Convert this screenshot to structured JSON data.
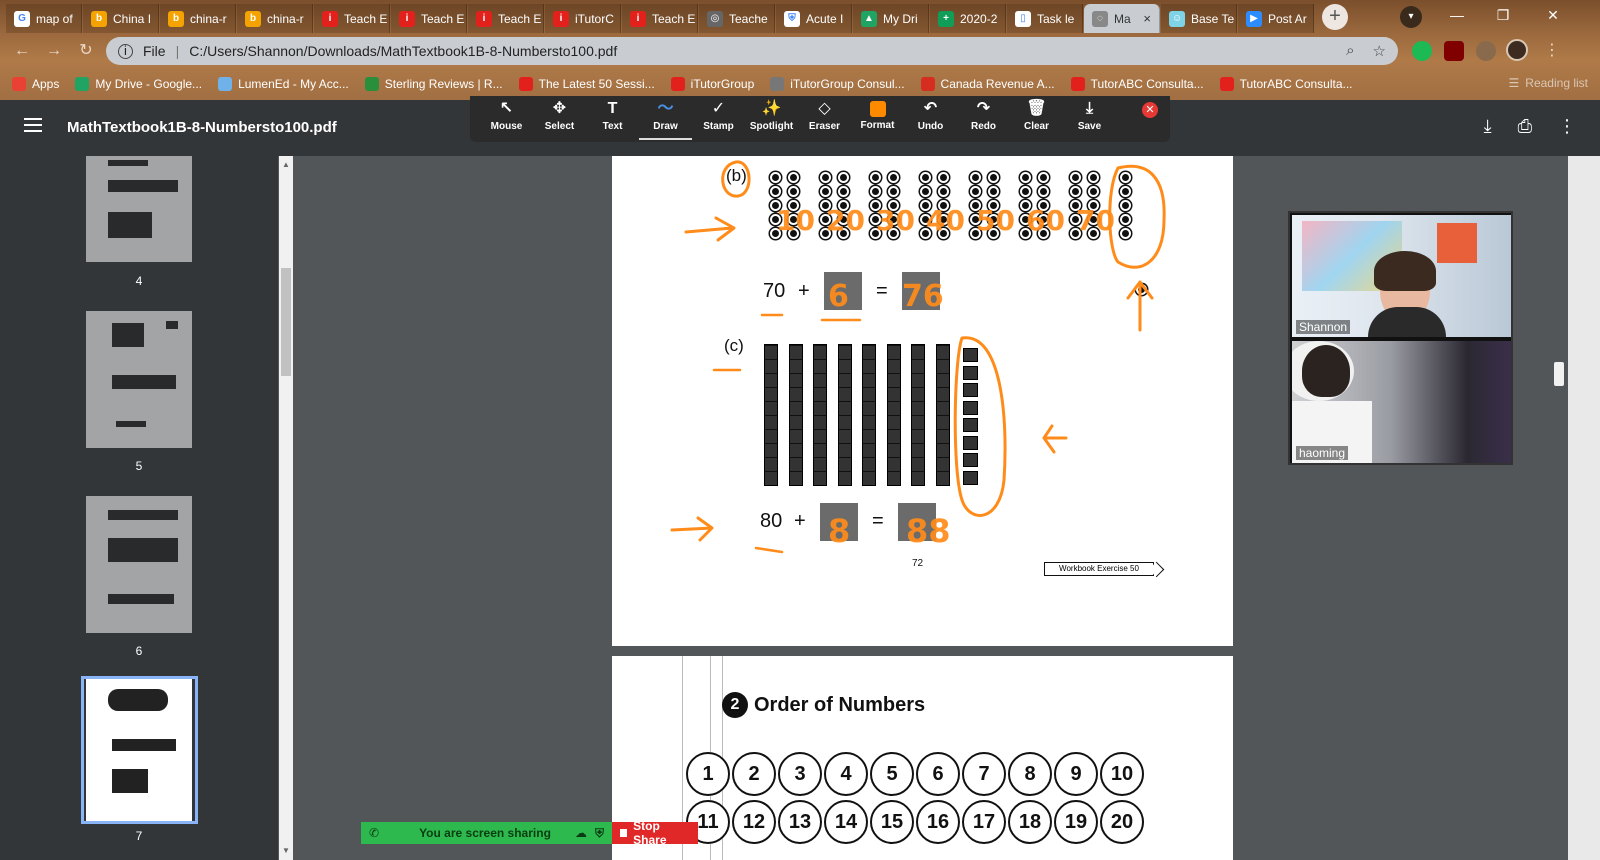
{
  "browser": {
    "tabs": [
      {
        "label": "map of",
        "color": "#ffffff",
        "glyph": "G"
      },
      {
        "label": "China I",
        "color": "#f4a300",
        "glyph": "b"
      },
      {
        "label": "china-r",
        "color": "#f4a300",
        "glyph": "b"
      },
      {
        "label": "china-r",
        "color": "#f4a300",
        "glyph": "b"
      },
      {
        "label": "Teach E",
        "color": "#e2211c",
        "glyph": "i"
      },
      {
        "label": "Teach E",
        "color": "#e2211c",
        "glyph": "i"
      },
      {
        "label": "Teach E",
        "color": "#e2211c",
        "glyph": "i"
      },
      {
        "label": "iTutorC",
        "color": "#e2211c",
        "glyph": "i"
      },
      {
        "label": "Teach E",
        "color": "#e2211c",
        "glyph": "i"
      },
      {
        "label": "Teache",
        "color": "#666666",
        "glyph": "◎"
      },
      {
        "label": "Acute I",
        "color": "#ffffff",
        "glyph": "⛨"
      },
      {
        "label": "My Dri",
        "color": "#1fa463",
        "glyph": "▲"
      },
      {
        "label": "2020-2",
        "color": "#0f9d58",
        "glyph": "+"
      },
      {
        "label": "Task le",
        "color": "#ffffff",
        "glyph": "▯"
      },
      {
        "label": "Ma",
        "color": "#888888",
        "glyph": "◌",
        "active": true
      },
      {
        "label": "Base Te",
        "color": "#7fd3e6",
        "glyph": "☺"
      },
      {
        "label": "Post Ar",
        "color": "#2d8cff",
        "glyph": "▶"
      }
    ],
    "new_tab": "+",
    "close_glyph": "×",
    "address": {
      "scheme": "File",
      "path": "C:/Users/Shannon/Downloads/MathTextbook1B-8-Numbersto100.pdf"
    },
    "bookmarks": [
      {
        "label": "Apps",
        "color": "#e94235"
      },
      {
        "label": "My Drive - Google...",
        "color": "#1fa463"
      },
      {
        "label": "LumenEd - My Acc...",
        "color": "#6fb1e8"
      },
      {
        "label": "Sterling Reviews | R...",
        "color": "#2a8f3a"
      },
      {
        "label": "The Latest 50 Sessi...",
        "color": "#e2211c"
      },
      {
        "label": "iTutorGroup",
        "color": "#e2211c"
      },
      {
        "label": "iTutorGroup Consul...",
        "color": "#777777"
      },
      {
        "label": "Canada Revenue A...",
        "color": "#d62d20"
      },
      {
        "label": "TutorABC Consulta...",
        "color": "#e2211c"
      },
      {
        "label": "TutorABC Consulta...",
        "color": "#e2211c"
      }
    ],
    "reading_list": "Reading list"
  },
  "viewer": {
    "file_title": "MathTextbook1B-8-Numbersto100.pdf",
    "thumbnail_numbers": [
      "4",
      "5",
      "6",
      "7"
    ]
  },
  "annotation_toolbar": {
    "tools": [
      {
        "label": "Mouse",
        "icon": "↖"
      },
      {
        "label": "Select",
        "icon": "✥"
      },
      {
        "label": "Text",
        "icon": "T"
      },
      {
        "label": "Draw",
        "icon": "〜",
        "selected": true
      },
      {
        "label": "Stamp",
        "icon": "✓"
      },
      {
        "label": "Spotlight",
        "icon": "✨"
      },
      {
        "label": "Eraser",
        "icon": "◇"
      },
      {
        "label": "Format",
        "icon": "fmt"
      },
      {
        "label": "Undo",
        "icon": "↶"
      },
      {
        "label": "Redo",
        "icon": "↷"
      },
      {
        "label": "Clear",
        "icon": "🗑"
      },
      {
        "label": "Save",
        "icon": "⤓"
      }
    ],
    "accent": "#ff8a00"
  },
  "page1": {
    "label_b": "(b)",
    "label_c": "(c)",
    "eq_b": {
      "left": "70",
      "plus": "+",
      "equals": "="
    },
    "eq_c": {
      "left": "80",
      "plus": "+",
      "equals": "="
    },
    "page_number": "72",
    "workbook_tag": "Workbook Exercise 50",
    "handwriting": {
      "b_counts": [
        "10",
        "20",
        "30",
        "40",
        "50",
        "60",
        "70"
      ],
      "b_answer_ones": "6",
      "b_answer_total": "76",
      "c_answer_ones": "8",
      "c_answer_total": "88"
    }
  },
  "page2": {
    "section_number": "2",
    "section_title": "Order of Numbers",
    "row1": [
      "1",
      "2",
      "3",
      "4",
      "5",
      "6",
      "7",
      "8",
      "9",
      "10"
    ],
    "row2": [
      "11",
      "12",
      "13",
      "14",
      "15",
      "16",
      "17",
      "18",
      "19",
      "20"
    ]
  },
  "video": {
    "participants": [
      {
        "name": "Shannon"
      },
      {
        "name": "haoming"
      }
    ]
  },
  "screen_share": {
    "status": "You are screen sharing",
    "stop_label": "Stop Share"
  },
  "ink_color": "#ff8c1a"
}
